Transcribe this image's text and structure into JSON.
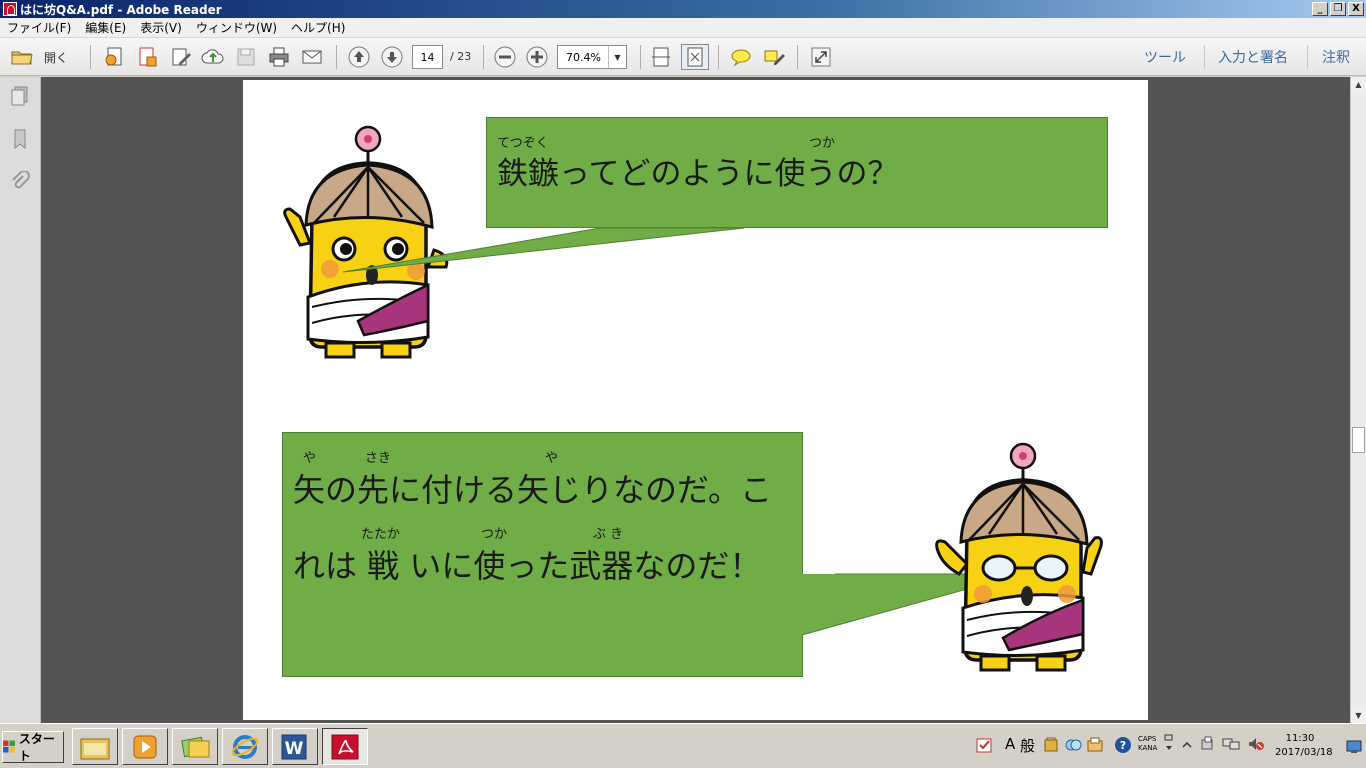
{
  "window": {
    "title": "はに坊Q&A.pdf - Adobe Reader",
    "controls": {
      "minimize": "_",
      "restore": "❐",
      "close": "X"
    }
  },
  "menu": [
    "ファイル(F)",
    "編集(E)",
    "表示(V)",
    "ウィンドウ(W)",
    "ヘルプ(H)"
  ],
  "toolbar": {
    "open_label": "開く",
    "page_current": "14",
    "page_total": "/ 23",
    "zoom_value": "70.4%",
    "right_tabs": [
      "ツール",
      "入力と署名",
      "注釈"
    ]
  },
  "document": {
    "question": {
      "ruby": [
        "てつぞく",
        "つか"
      ],
      "text": "鉄鏃ってどのように使うの？"
    },
    "answer": {
      "line1_ruby": [
        "や",
        "さき",
        "や"
      ],
      "line1": "矢の先に付ける矢じりなのだ。こ",
      "line2_ruby": [
        "たたか",
        "つか",
        "ぶ き"
      ],
      "line2": "れは 戦 いに使った武器なのだ！"
    }
  },
  "taskbar": {
    "start_label": "スタート",
    "ime": [
      "A",
      "般"
    ],
    "caps_lines": [
      "CAPS",
      "KANA"
    ],
    "clock_time": "11:30",
    "clock_date": "2017/03/18"
  }
}
